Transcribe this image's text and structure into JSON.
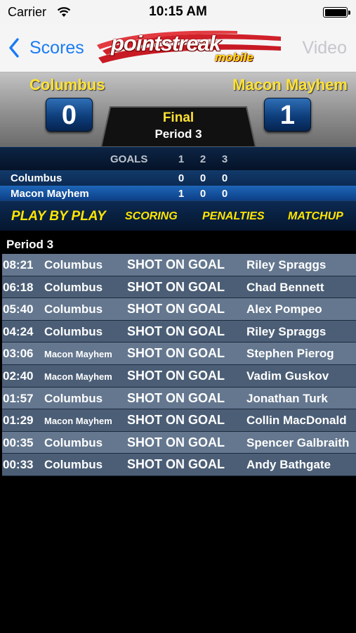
{
  "status_bar": {
    "carrier": "Carrier",
    "time": "10:15 AM"
  },
  "nav": {
    "back_label": "Scores",
    "logo_text": "pointstreak",
    "logo_subtext": "mobile",
    "right_label": "Video"
  },
  "game": {
    "home_team": "Columbus",
    "away_team": "Macon Mayhem",
    "home_score": "0",
    "away_score": "1",
    "status": "Final",
    "period": "Period 3"
  },
  "goals_table": {
    "header": {
      "label": "GOALS",
      "p1": "1",
      "p2": "2",
      "p3": "3"
    },
    "rows": [
      {
        "team": "Columbus",
        "p1": "0",
        "p2": "0",
        "p3": "0"
      },
      {
        "team": "Macon Mayhem",
        "p1": "1",
        "p2": "0",
        "p3": "0"
      }
    ]
  },
  "tabs": [
    "PLAY BY PLAY",
    "SCORING",
    "PENALTIES",
    "MATCHUP"
  ],
  "play_by_play": {
    "period_label": "Period 3",
    "plays": [
      {
        "time": "08:21",
        "team": "Columbus",
        "type": "SHOT ON GOAL",
        "player": "Riley Spraggs"
      },
      {
        "time": "06:18",
        "team": "Columbus",
        "type": "SHOT ON GOAL",
        "player": "Chad Bennett"
      },
      {
        "time": "05:40",
        "team": "Columbus",
        "type": "SHOT ON GOAL",
        "player": "Alex Pompeo"
      },
      {
        "time": "04:24",
        "team": "Columbus",
        "type": "SHOT ON GOAL",
        "player": "Riley Spraggs"
      },
      {
        "time": "03:06",
        "team": "Macon Mayhem",
        "type": "SHOT ON GOAL",
        "player": "Stephen Pierog"
      },
      {
        "time": "02:40",
        "team": "Macon Mayhem",
        "type": "SHOT ON GOAL",
        "player": "Vadim Guskov"
      },
      {
        "time": "01:57",
        "team": "Columbus",
        "type": "SHOT ON GOAL",
        "player": "Jonathan Turk"
      },
      {
        "time": "01:29",
        "team": "Macon Mayhem",
        "type": "SHOT ON GOAL",
        "player": "Collin MacDonald"
      },
      {
        "time": "00:35",
        "team": "Columbus",
        "type": "SHOT ON GOAL",
        "player": "Spencer Galbraith"
      },
      {
        "time": "00:33",
        "team": "Columbus",
        "type": "SHOT ON GOAL",
        "player": "Andy Bathgate"
      }
    ]
  },
  "icons": {
    "wifi": "wifi-icon",
    "battery": "battery-icon",
    "back": "chevron-left-icon"
  },
  "colors": {
    "accent_blue": "#1a7cf4",
    "team_yellow": "#ffe234",
    "tab_yellow": "#ffe600",
    "logo_red": "#d0202a"
  }
}
